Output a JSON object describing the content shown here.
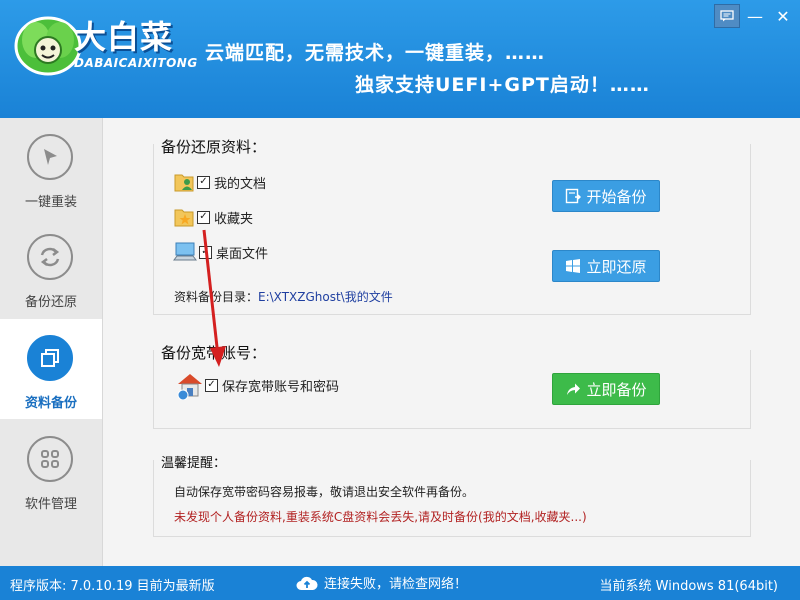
{
  "app": {
    "brand_title": "大白菜",
    "brand_subtitle": "DABAICAIXITONG",
    "slogan_line1": "云端匹配，无需技术，一键重装，……",
    "slogan_line2": "独家支持UEFI+GPT启动！……"
  },
  "window": {
    "message_icon": "message-icon",
    "minimize_label": "—",
    "close_label": "✕"
  },
  "sidebar": {
    "items": [
      {
        "label": "一键重装",
        "icon": "cursor-arrow-icon"
      },
      {
        "label": "备份还原",
        "icon": "refresh-cycle-icon"
      },
      {
        "label": "资料备份",
        "icon": "copy-windows-icon",
        "active": true
      },
      {
        "label": "软件管理",
        "icon": "grid-dots-icon"
      }
    ]
  },
  "backup_section": {
    "title": "备份还原资料：",
    "items": [
      {
        "label": "我的文档",
        "checked": true,
        "icon": "user-folder-icon"
      },
      {
        "label": "收藏夹",
        "checked": true,
        "icon": "star-folder-icon"
      },
      {
        "label": "桌面文件",
        "checked": true,
        "icon": "desktop-computer-icon"
      }
    ],
    "start_backup_label": "开始备份",
    "restore_now_label": "立即还原",
    "directory_label": "资料备份目录：",
    "directory_value": "E:\\XTXZGhost\\我的文件"
  },
  "broadband_section": {
    "title": "备份宽带账号：",
    "item_label": "保存宽带账号和密码",
    "item_checked": true,
    "item_icon": "house-network-icon",
    "backup_now_label": "立即备份"
  },
  "tips_section": {
    "title": "温馨提醒：",
    "line1": "自动保存宽带密码容易报毒，敬请退出安全软件再备份。",
    "line2": "未发现个人备份资料,重装系统C盘资料会丢失,请及时备份(我的文档,收藏夹...)"
  },
  "status_bar": {
    "version_text": "程序版本: 7.0.10.19 目前为最新版",
    "connection_text": "连接失败，请检查网络！",
    "system_text": "当前系统 Windows 81(64bit)"
  },
  "colors": {
    "accent": "#1a82d6",
    "blue_button": "#3b9ee3",
    "green_button": "#3dbb4a",
    "warning_text": "#b22222",
    "annotation_arrow": "#d42020"
  }
}
